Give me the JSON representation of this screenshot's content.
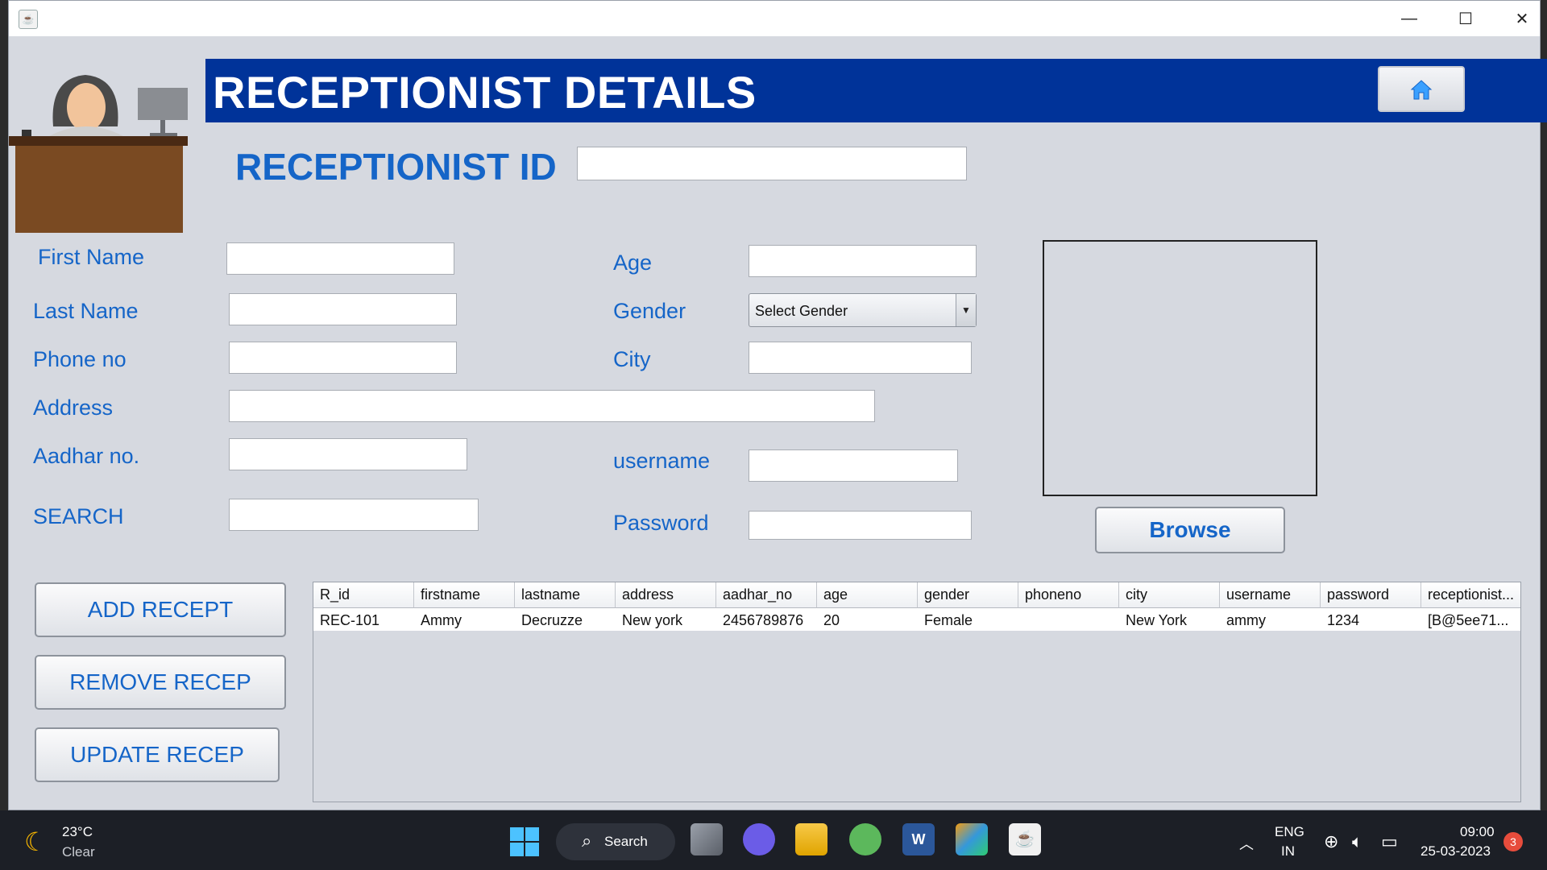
{
  "header": {
    "title": "RECEPTIONIST DETAILS"
  },
  "receptionist_id": {
    "label": "RECEPTIONIST ID",
    "value": ""
  },
  "form": {
    "first_name": {
      "label": "First Name",
      "value": ""
    },
    "last_name": {
      "label": "Last Name",
      "value": ""
    },
    "phone": {
      "label": "Phone no",
      "value": ""
    },
    "address": {
      "label": "Address",
      "value": ""
    },
    "aadhar": {
      "label": "Aadhar no.",
      "value": ""
    },
    "search": {
      "label": "SEARCH",
      "value": ""
    },
    "age": {
      "label": "Age",
      "value": ""
    },
    "gender": {
      "label": "Gender",
      "selected": "Select Gender"
    },
    "city": {
      "label": "City",
      "value": ""
    },
    "username": {
      "label": "username",
      "value": ""
    },
    "password": {
      "label": "Password",
      "value": ""
    }
  },
  "buttons": {
    "browse": "Browse",
    "add": "ADD RECEPT",
    "remove": "REMOVE RECEP",
    "update": "UPDATE RECEP"
  },
  "table": {
    "columns": [
      "R_id",
      "firstname",
      "lastname",
      "address",
      "aadhar_no",
      "age",
      "gender",
      "phoneno",
      "city",
      "username",
      "password",
      "receptionist..."
    ],
    "rows": [
      [
        "REC-101",
        "Ammy",
        "Decruzze",
        "New york",
        "2456789876",
        "20",
        "Female",
        "",
        "New York",
        "ammy",
        "1234",
        "[B@5ee71..."
      ]
    ]
  },
  "taskbar": {
    "weather_temp": "23°C",
    "weather_text": "Clear",
    "search_label": "Search",
    "lang_top": "ENG",
    "lang_bottom": "IN",
    "time": "09:00",
    "date": "25-03-2023",
    "notification_count": "3"
  },
  "colors": {
    "header_band": "#003399",
    "label_blue": "#1565c8",
    "window_bg": "#d6d9e0"
  }
}
